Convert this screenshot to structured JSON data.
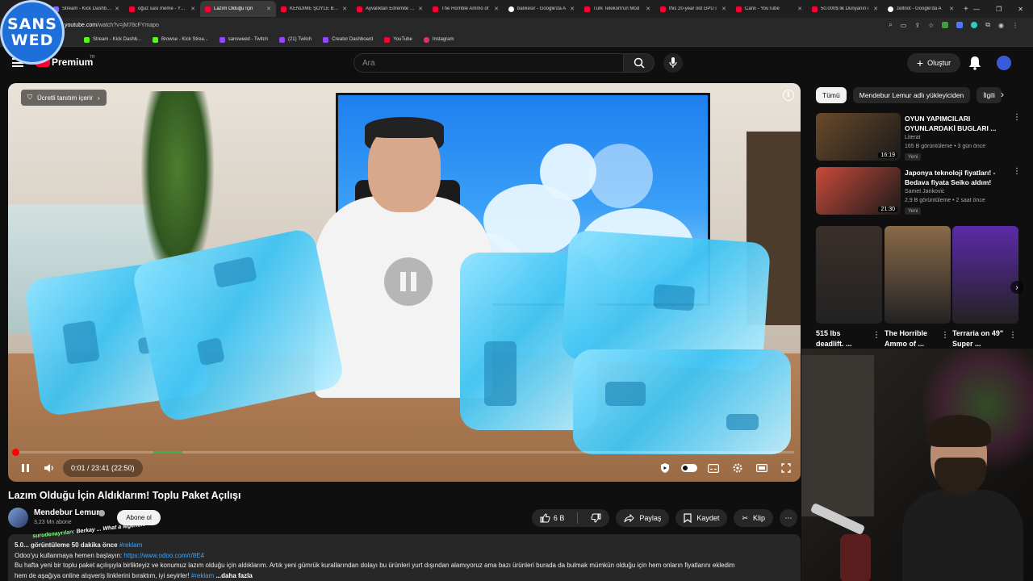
{
  "logo": {
    "line1": "SANS",
    "line2": "WED"
  },
  "tabs": [
    {
      "label": "Stream - Kick Dashboard - Wa",
      "favicon": "kick-icon",
      "active": false
    },
    {
      "label": "oğuz sasi meme - YouTube",
      "favicon": "youtube-icon",
      "active": false
    },
    {
      "label": "Lazım Olduğu İçin",
      "favicon": "youtube-icon",
      "active": true
    },
    {
      "label": "KENDİME ŞÖYLE BİR Ş",
      "favicon": "youtube-icon",
      "active": false
    },
    {
      "label": "Ayvalıktan Edremite do",
      "favicon": "youtube-icon",
      "active": false
    },
    {
      "label": "The Horrible Ammo of",
      "favicon": "youtube-icon",
      "active": false
    },
    {
      "label": "balıkesir - Google'da A",
      "favicon": "google-icon",
      "active": false
    },
    {
      "label": "Türk Telekom'un Mod",
      "favicon": "youtube-icon",
      "active": false
    },
    {
      "label": "this 20-year old GPU i",
      "favicon": "youtube-icon",
      "active": false
    },
    {
      "label": "Canlı - YouTube",
      "favicon": "youtube-icon",
      "active": false
    },
    {
      "label": "50.000$ lik Dünyanın i",
      "favicon": "youtube-icon",
      "active": false
    },
    {
      "label": "zeltnot - Google'da A",
      "favicon": "google-icon",
      "active": false
    }
  ],
  "address": {
    "url_prefix": "youtube.com",
    "url_rest": "/watch?v=jM78cFYmapo"
  },
  "bookmarks": [
    {
      "label": "Stream - Kick Dashb...",
      "icon": "kick-icon"
    },
    {
      "label": "Browse - Kick Strea...",
      "icon": "kick-icon"
    },
    {
      "label": "sansweed - Twitch",
      "icon": "twitch-icon"
    },
    {
      "label": "(21) Twitch",
      "icon": "twitch-icon"
    },
    {
      "label": "Creator Dashboard",
      "icon": "twitch-icon"
    },
    {
      "label": "YouTube",
      "icon": "youtube-icon"
    },
    {
      "label": "Instagram",
      "icon": "instagram-icon"
    }
  ],
  "masthead": {
    "brand": "Premium",
    "brand_tag": "TR",
    "search_placeholder": "Ara",
    "create_label": "Oluştur"
  },
  "player": {
    "sponsor_label": "Ücretli tanıtım içerir",
    "time": "0:01 / 23:41 (22:50)",
    "progress_fraction": 0.0007,
    "playing": true
  },
  "video": {
    "title": "Lazım Olduğu İçin Aldıklarım! Toplu Paket Açılışı",
    "channel": "Mendebur Lemur",
    "subscribers": "3,23 Mn abone",
    "subscribe_label": "Abone ol",
    "likes": "6 B",
    "share_label": "Paylaş",
    "save_label": "Kaydet",
    "clip_label": "Klip"
  },
  "description": {
    "views_time": "5.0... görüntüleme  50 dakika önce",
    "hashtag_top": "#reklam",
    "line2_text": "Odoo'yu kullanmaya hemen başlayın: ",
    "line2_link": "https://www.odoo.com/r/8E4",
    "line3": "Bu hafta yeni bir toplu paket açılışıyla birlikteyiz ve konumuz lazım olduğu için aldıklarım. Artık yeni gümrük kurallarından dolayı bu ürünleri yurt dışından alamıyoruz ama bazı ürünleri burada da bulmak mümkün olduğu için hem onların fiyatlarını ekledim",
    "line4": "hem de aşağıya online alışveriş linklerini bıraktım, iyi seyirler! ",
    "hashtag_bottom": "#reklam",
    "more_label": "...daha fazla"
  },
  "chat_overlay": {
    "user": "surudenayrılan",
    "message": ": Berkay ... What a legend..."
  },
  "chips": [
    {
      "label": "Tümü",
      "active": true
    },
    {
      "label": "Mendebur Lemur adlı yükleyiciden",
      "active": false
    },
    {
      "label": "İlgili",
      "active": false
    }
  ],
  "recommendations": [
    {
      "title": "OYUN YAPIMCILARI OYUNLARDAKİ BUGLARI ...",
      "channel": "Literat",
      "stats": "165 B görüntüleme • 3 gün önce",
      "badge": "Yeni",
      "duration": "16:19",
      "thumb_color": "#6b4a2a"
    },
    {
      "title": "Japonya teknoloji fiyatları! - Bedava fiyata Seiko aldım!",
      "channel": "Samet Jankovic",
      "stats": "2,9 B görüntüleme • 2 saat önce",
      "badge": "Yeni",
      "duration": "21:30",
      "thumb_color": "#c94a3a"
    }
  ],
  "shorts": [
    {
      "title": "515 lbs deadlift. ...",
      "thumb_color": "#3a2f2a"
    },
    {
      "title": "The Horrible Ammo of ...",
      "thumb_color": "#8a6a4a"
    },
    {
      "title": "Terraria on 49\" Super ...",
      "thumb_color": "#5b2aa8"
    }
  ]
}
